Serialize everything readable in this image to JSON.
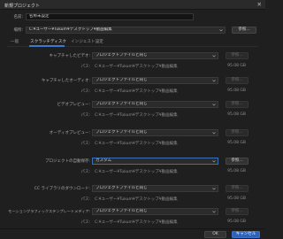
{
  "window": {
    "title": "新規プロジェクト",
    "close_glyph": "✕"
  },
  "form": {
    "name_label": "名前:",
    "name_value": "名称未設定",
    "location_label": "場所:",
    "location_value": "C:¥ユーザー¥Tukum¥デスクトップ¥動画編集",
    "browse_label": "参照..."
  },
  "tabs": [
    {
      "label": "一般",
      "active": false
    },
    {
      "label": "スクラッチディスク",
      "active": true
    },
    {
      "label": "インジェスト設定",
      "active": false
    }
  ],
  "scratch": [
    {
      "label": "キャプチャしたビデオ:",
      "value": "プロジェクトファイルと同じ",
      "path_label": "パス:",
      "path": "C:¥ユーザー¥Tukum¥デスクトップ¥動画編集",
      "space": "95.08 GB",
      "browse": "参照...",
      "browse_enabled": false
    },
    {
      "label": "キャプチャしたオーディオ:",
      "value": "プロジェクトファイルと同じ",
      "path_label": "パス:",
      "path": "C:¥ユーザー¥Tukum¥デスクトップ¥動画編集",
      "space": "95.08 GB",
      "browse": "参照...",
      "browse_enabled": false
    },
    {
      "label": "ビデオプレビュー:",
      "value": "プロジェクトファイルと同じ",
      "path_label": "パス:",
      "path": "C:¥ユーザー¥Tukum¥デスクトップ¥動画編集",
      "space": "95.08 GB",
      "browse": "参照...",
      "browse_enabled": false
    },
    {
      "label": "オーディオプレビュー:",
      "value": "プロジェクトファイルと同じ",
      "path_label": "パス:",
      "path": "C:¥ユーザー¥Tukum¥デスクトップ¥動画編集",
      "space": "95.08 GB",
      "browse": "参照...",
      "browse_enabled": false
    },
    {
      "label": "プロジェクトの自動保存:",
      "value": "カスタム",
      "path_label": "パス:",
      "path": "C:¥ユーザー¥Tukum¥デスクトップ¥動画編集",
      "space": "95.08 GB",
      "browse": "参照...",
      "browse_enabled": true
    },
    {
      "label": "CC ライブラリのダウンロード:",
      "value": "プロジェクトファイルと同じ",
      "path_label": "パス:",
      "path": "C:¥ユーザー¥Tukum¥デスクトップ¥動画編集",
      "space": "95.08 GB",
      "browse": "参照...",
      "browse_enabled": false
    },
    {
      "label": "モーショングラフィックステンプレートメディア:",
      "value": "プロジェクトファイルと同じ",
      "path_label": "パス:",
      "path": "C:¥ユーザー¥Tukum¥デスクトップ¥動画編集",
      "space": "95.08 GB",
      "browse": "参照...",
      "browse_enabled": false
    }
  ],
  "footer": {
    "ok_label": "OK",
    "cancel_label": "キャンセル"
  },
  "colors": {
    "accent": "#2e63b8",
    "tab_underline": "#3b78d1",
    "background": "#1f1f1f"
  }
}
